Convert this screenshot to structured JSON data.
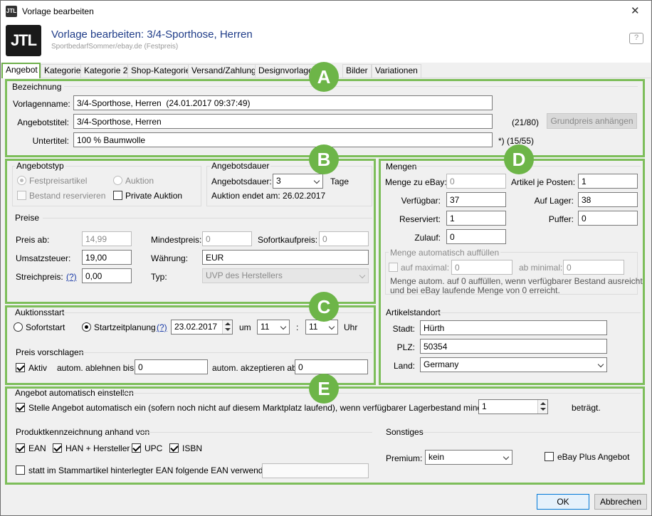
{
  "window": {
    "title": "Vorlage bearbeiten",
    "close_label": "✕"
  },
  "header": {
    "title": "Vorlage bearbeiten: 3/4-Sporthose, Herren",
    "subtitle": "SportbedarfSommer/ebay.de (Festpreis)",
    "logo": "JTL"
  },
  "tabs": [
    "Angebot",
    "Kategorie",
    "Kategorie 2",
    "Shop-Kategorie",
    "Versand/Zahlung",
    "Designvorlage",
    "Bilder",
    "Variationen"
  ],
  "markers": {
    "a": "A",
    "b": "B",
    "c": "C",
    "d": "D",
    "e": "E"
  },
  "bezeichnung": {
    "group": "Bezeichnung",
    "vorlagenname_label": "Vorlagenname:",
    "vorlagenname": "3/4-Sporthose, Herren  (24.01.2017 09:37:49)",
    "titel_label": "Angebotstitel:",
    "titel": "3/4-Sporthose, Herren",
    "titel_count": "(21/80)",
    "grundpreis_btn": "Grundpreis anhängen",
    "untertitel_label": "Untertitel:",
    "untertitel": "100 % Baumwolle",
    "untertitel_count": "*)  (15/55)"
  },
  "angebotstyp": {
    "group": "Angebotstyp",
    "festpreis": "Festpreisartikel",
    "auktion": "Auktion",
    "bestand": "Bestand reservieren",
    "privat": "Private Auktion"
  },
  "angebotsdauer": {
    "group": "Angebotsdauer",
    "label": "Angebotsdauer:",
    "value": "3",
    "unit": "Tage",
    "ende": "Auktion endet am: 26.02.2017"
  },
  "preise": {
    "group": "Preise",
    "preis_ab_label": "Preis ab:",
    "preis_ab": "14,99",
    "mindest_label": "Mindestpreis:",
    "mindest": "0",
    "sofort_label": "Sofortkaufpreis:",
    "sofort": "0",
    "ust_label": "Umsatzsteuer:",
    "ust": "19,00",
    "waehrung_label": "Währung:",
    "waehrung": "EUR",
    "streich_label": "Streichpreis:",
    "help": "(?)",
    "streich": "0,00",
    "typ_label": "Typ:",
    "typ": "UVP des Herstellers"
  },
  "auktionsstart": {
    "group": "Auktionsstart",
    "sofort": "Sofortstart",
    "zeitplanung": "Startzeitplanung",
    "help": "(?)",
    "datum": "23.02.2017",
    "um": "um",
    "stunde": "11",
    "colon": ":",
    "minute": "11",
    "uhr": "Uhr"
  },
  "vorschlag": {
    "group": "Preis vorschlagen",
    "aktiv": "Aktiv",
    "ablehnen_label": "autom. ablehnen bis:",
    "ablehnen": "0",
    "akzeptieren_label": "autom. akzeptieren ab:",
    "akzeptieren": "0"
  },
  "mengen": {
    "group": "Mengen",
    "zu_ebay_label": "Menge zu eBay:",
    "zu_ebay": "0",
    "je_posten_label": "Artikel je Posten:",
    "je_posten": "1",
    "verfuegbar_label": "Verfügbar:",
    "verfuegbar": "37",
    "lager_label": "Auf Lager:",
    "lager": "38",
    "reserviert_label": "Reserviert:",
    "reserviert": "1",
    "puffer_label": "Puffer:",
    "puffer": "0",
    "zulauf_label": "Zulauf:",
    "zulauf": "0",
    "auto_group": "Menge automatisch auffüllen",
    "max_label": "auf maximal:",
    "max": "0",
    "min_label": "ab minimal:",
    "min": "0",
    "hinweis1": "Menge autom. auf 0 auffüllen, wenn verfügbarer Bestand ausreicht",
    "hinweis2": "und bei eBay laufende Menge von 0 erreicht."
  },
  "standort": {
    "group": "Artikelstandort",
    "stadt_label": "Stadt:",
    "stadt": "Hürth",
    "plz_label": "PLZ:",
    "plz": "50354",
    "land_label": "Land:",
    "land": "Germany"
  },
  "auto": {
    "group": "Angebot automatisch einstellen",
    "text": "Stelle Angebot automatisch ein (sofern noch nicht auf diesem Marktplatz laufend), wenn verfügbarer Lagerbestand mindestens",
    "wert": "1",
    "betraegt": "beträgt."
  },
  "produkt": {
    "group": "Produktkennzeichnung anhand von",
    "ean": "EAN",
    "han": "HAN + Hersteller",
    "upc": "UPC",
    "isbn": "ISBN",
    "stamm": "statt im Stammartikel hinterlegter EAN folgende EAN verwenden:"
  },
  "sonstiges": {
    "group": "Sonstiges",
    "premium_label": "Premium:",
    "premium": "kein",
    "ebayplus": "eBay Plus Angebot"
  },
  "footer": {
    "ok": "OK",
    "abbrechen": "Abbrechen"
  },
  "colors": {
    "accent": "#6db548",
    "header_title": "#1f3c88"
  }
}
